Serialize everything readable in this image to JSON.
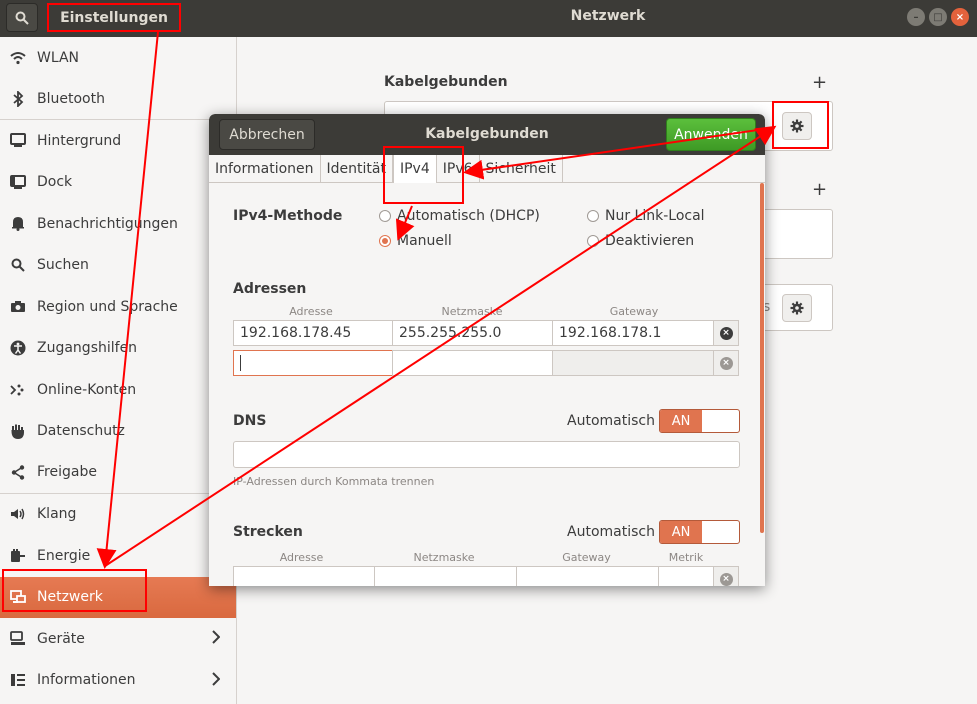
{
  "header": {
    "app_title": "Einstellungen",
    "panel_title": "Netzwerk"
  },
  "sidebar": {
    "items": [
      {
        "label": "WLAN",
        "icon": "wifi-icon"
      },
      {
        "label": "Bluetooth",
        "icon": "bluetooth-icon"
      },
      {
        "label": "Hintergrund",
        "icon": "monitor-icon"
      },
      {
        "label": "Dock",
        "icon": "dock-icon"
      },
      {
        "label": "Benachrichtigungen",
        "icon": "bell-icon"
      },
      {
        "label": "Suchen",
        "icon": "search-icon"
      },
      {
        "label": "Region und Sprache",
        "icon": "camera-icon"
      },
      {
        "label": "Zugangshilfen",
        "icon": "accessibility-icon"
      },
      {
        "label": "Online-Konten",
        "icon": "online-accounts-icon"
      },
      {
        "label": "Datenschutz",
        "icon": "hand-icon"
      },
      {
        "label": "Freigabe",
        "icon": "share-icon"
      },
      {
        "label": "Klang",
        "icon": "speaker-icon"
      },
      {
        "label": "Energie",
        "icon": "power-icon"
      },
      {
        "label": "Netzwerk",
        "icon": "network-icon"
      },
      {
        "label": "Geräte",
        "icon": "devices-icon"
      },
      {
        "label": "Informationen",
        "icon": "info-icon"
      }
    ],
    "active": "Netzwerk"
  },
  "main": {
    "wired_title": "Kabelgebunden",
    "partial_label": "s"
  },
  "dialog": {
    "cancel": "Abbrechen",
    "title": "Kabelgebunden",
    "apply": "Anwenden",
    "tabs": [
      "Informationen",
      "Identität",
      "IPv4",
      "IPv6",
      "Sicherheit"
    ],
    "active_tab": "IPv4",
    "ipv4_method_label": "IPv4-Methode",
    "methods": [
      {
        "label": "Automatisch (DHCP)",
        "selected": false
      },
      {
        "label": "Nur Link-Local",
        "selected": false
      },
      {
        "label": "Manuell",
        "selected": true
      },
      {
        "label": "Deaktivieren",
        "selected": false
      }
    ],
    "addresses_label": "Adressen",
    "addr_headers": [
      "Adresse",
      "Netzmaske",
      "Gateway"
    ],
    "address_rows": [
      {
        "address": "192.168.178.45",
        "netmask": "255.255.255.0",
        "gateway": "192.168.178.1"
      },
      {
        "address": "",
        "netmask": "",
        "gateway": ""
      }
    ],
    "dns_label": "DNS",
    "automatic_label": "Automatisch",
    "switch_on": "AN",
    "dns_value": "",
    "dns_hint": "IP-Adressen durch Kommata trennen",
    "routes_label": "Strecken",
    "route_headers": [
      "Adresse",
      "Netzmaske",
      "Gateway",
      "Metrik"
    ]
  },
  "colors": {
    "accent": "#e0744f",
    "header": "#3c3b37",
    "apply_green": "#4aaa2e",
    "annotation_red": "#ff0000"
  }
}
